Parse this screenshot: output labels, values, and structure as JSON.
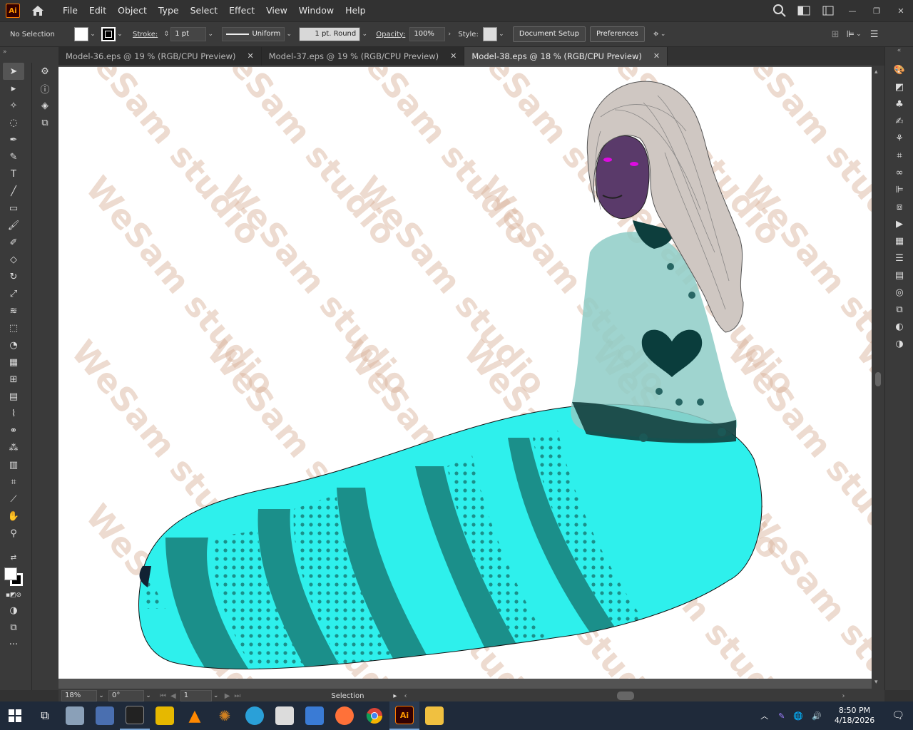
{
  "app": {
    "logo": "Ai"
  },
  "menu": [
    "File",
    "Edit",
    "Object",
    "Type",
    "Select",
    "Effect",
    "View",
    "Window",
    "Help"
  ],
  "control": {
    "selection": "No Selection",
    "stroke_label": "Stroke:",
    "stroke_weight": "1 pt",
    "stroke_profile": "Uniform",
    "brush": "1 pt. Round",
    "opacity_label": "Opacity:",
    "opacity": "100%",
    "style_label": "Style:",
    "doc_setup": "Document Setup",
    "preferences": "Preferences"
  },
  "tabs": [
    {
      "label": "Model-36.eps @ 19 % (RGB/CPU Preview)"
    },
    {
      "label": "Model-37.eps @ 19 % (RGB/CPU Preview)"
    },
    {
      "label": "Model-38.eps @ 18 % (RGB/CPU Preview)"
    }
  ],
  "status": {
    "zoom": "18%",
    "rotation": "0°",
    "artboard": "1",
    "tool": "Selection"
  },
  "watermark": "WeSam studio",
  "taskbar": {
    "time": "8:50 PM",
    "date": "4/18/2026"
  },
  "colors": {
    "accent": "#ff9a00",
    "dress": "#2ef0ec",
    "dress_dark": "#1b8f8a",
    "skin": "#5a3a6a"
  }
}
